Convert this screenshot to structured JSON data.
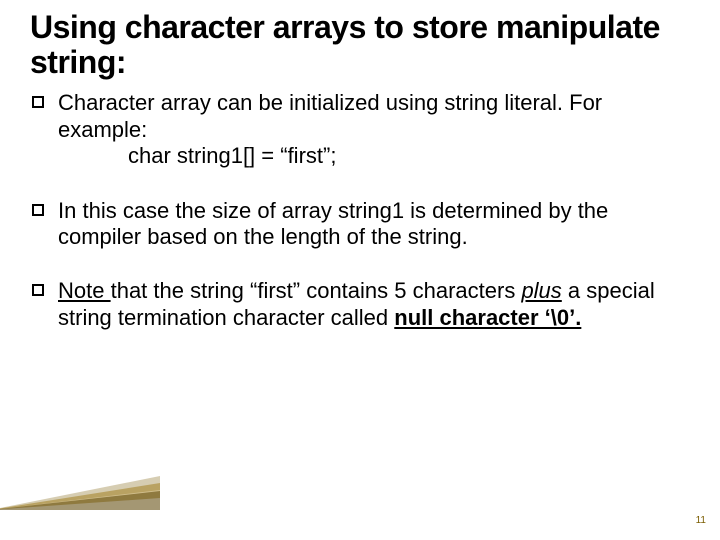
{
  "title": "Using character arrays to store manipulate string:",
  "bullets": [
    {
      "lead": "Character",
      "rest": " array can be initialized using string literal. For example:",
      "code": "char   string1[] = “first”;"
    },
    {
      "lead": "In",
      "rest": " this case the size of array string1 is determined by the compiler based on the length of the string."
    },
    {
      "lead": "Note ",
      "mid1": "that the string “first” contains 5 characters ",
      "plus": "plus",
      "mid2": " a special string termination character called ",
      "null_char": "null character ‘\\0’."
    }
  ],
  "page_number": "11"
}
